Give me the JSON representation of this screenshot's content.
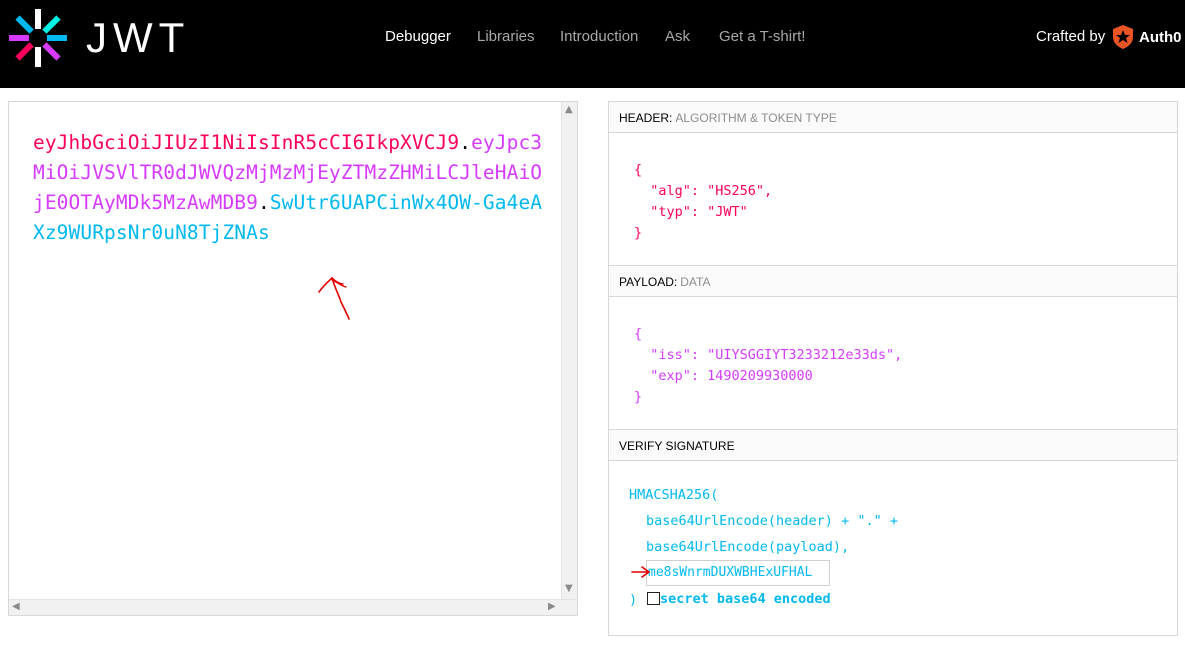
{
  "header": {
    "logo_text": "JWT",
    "nav": [
      "Debugger",
      "Libraries",
      "Introduction",
      "Ask",
      "Get a T-shirt!"
    ],
    "active_nav": "Debugger",
    "crafted_by": "Crafted by",
    "brand": "Auth0"
  },
  "encoded": {
    "header_part": "eyJhbGciOiJIUzI1NiIsInR5cCI6IkpXVCJ9",
    "payload_part": "eyJpc3MiOiJVSVlTR0dJWVQzMjMzMjEyZTMzZHMiLCJleHAiOjE0OTAyMDk5MzAwMDB9",
    "signature_part": "SwUtr6UAPCinWx4OW-Ga4eAXz9WURpsNr0uN8TjZNAs",
    "dot": "."
  },
  "decoded": {
    "header_title": "HEADER:",
    "header_subtitle": "ALGORITHM & TOKEN TYPE",
    "header_json": "{\n  \"alg\": \"HS256\",\n  \"typ\": \"JWT\"\n}",
    "payload_title": "PAYLOAD:",
    "payload_subtitle": "DATA",
    "payload_json": "{\n  \"iss\": \"UIYSGGIYT3233212e33ds\",\n  \"exp\": 1490209930000\n}",
    "verify_title": "VERIFY SIGNATURE",
    "verify_func": "HMACSHA256(",
    "verify_line1": "base64UrlEncode(header) + \".\" +",
    "verify_line2": "base64UrlEncode(payload),",
    "secret_value": "me8sWnrmDUXWBHExUFHAL",
    "verify_close": ")",
    "b64_label": "secret base64 encoded"
  },
  "colors": {
    "header_red": "#fb015b",
    "payload_purple": "#d63aff",
    "signature_blue": "#00b9f1",
    "annotation_red": "#e00000"
  }
}
